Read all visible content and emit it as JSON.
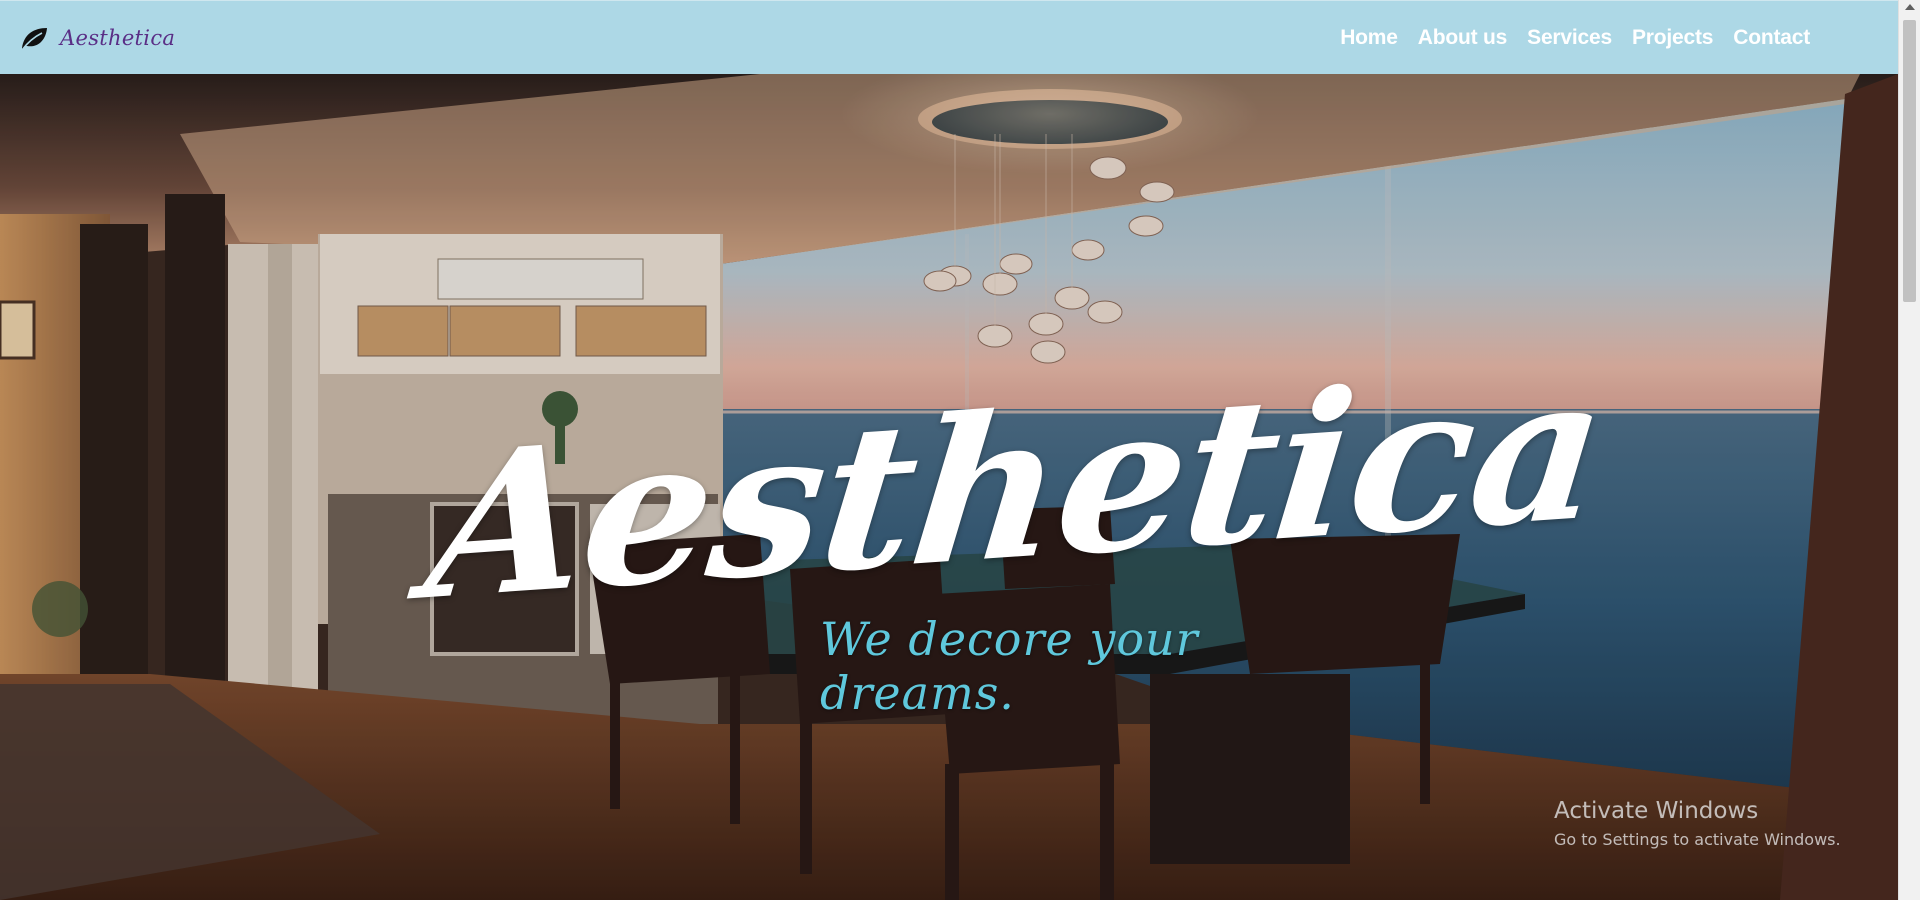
{
  "brand": {
    "name": "Aesthetica",
    "icon": "leaf-icon"
  },
  "nav": {
    "items": [
      {
        "label": "Home"
      },
      {
        "label": "About us"
      },
      {
        "label": "Services"
      },
      {
        "label": "Projects"
      },
      {
        "label": "Contact"
      }
    ]
  },
  "hero": {
    "title": "Aesthetica",
    "subtitle": "We decore your dreams."
  },
  "watermark": {
    "title": "Activate Windows",
    "subtitle": "Go to Settings to activate Windows."
  },
  "colors": {
    "navbar_bg": "#add8e6",
    "brand_text": "#5a2e86",
    "subtitle": "#5fc8dc",
    "nav_text": "#ffffff"
  }
}
